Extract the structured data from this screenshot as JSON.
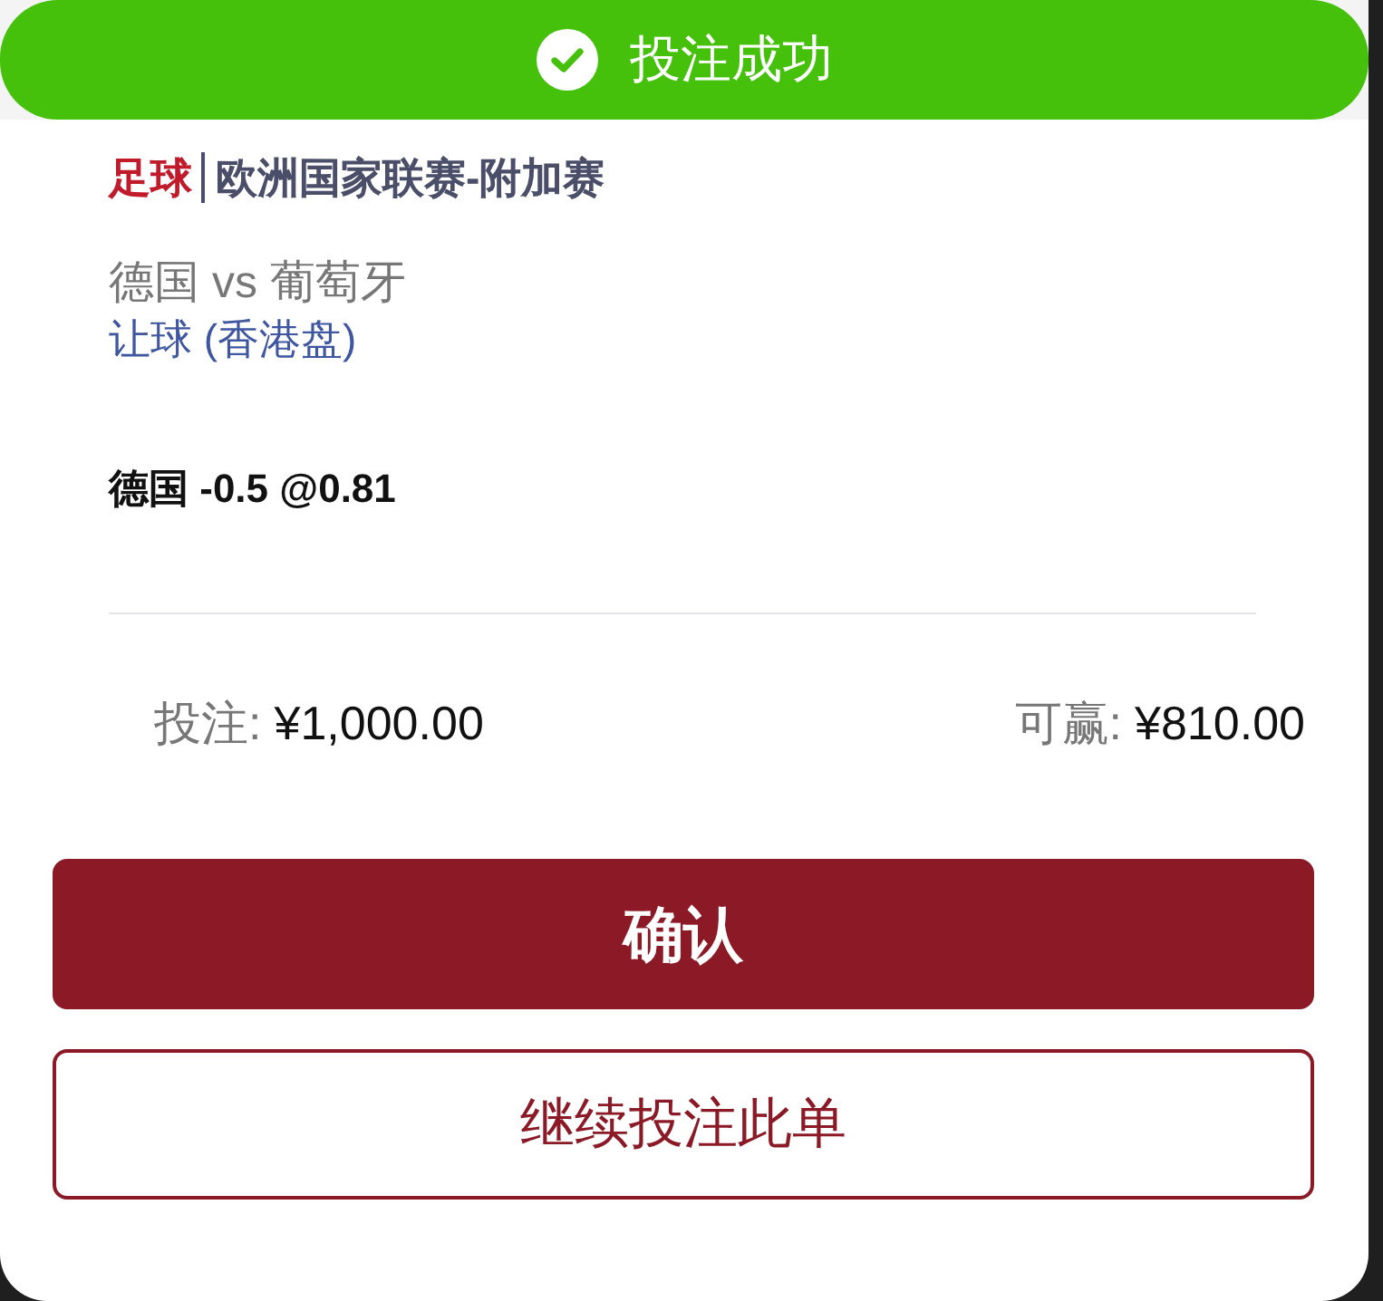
{
  "toast": {
    "kind": "success",
    "message": "投注成功"
  },
  "league": {
    "sport": "足球",
    "name": "欧洲国家联赛-附加赛"
  },
  "match": {
    "teams": "德国 vs 葡萄牙",
    "market": "让球 (香港盘)"
  },
  "selection": "德国 -0.5 @0.81",
  "summary": [
    {
      "label": "投注:",
      "value": "¥1,000.00"
    },
    {
      "label": "可赢:",
      "value": "¥810.00"
    }
  ],
  "buttons": [
    {
      "label": "确认",
      "kind": "primary"
    },
    {
      "label": "继续投注此单",
      "kind": "outline"
    }
  ]
}
